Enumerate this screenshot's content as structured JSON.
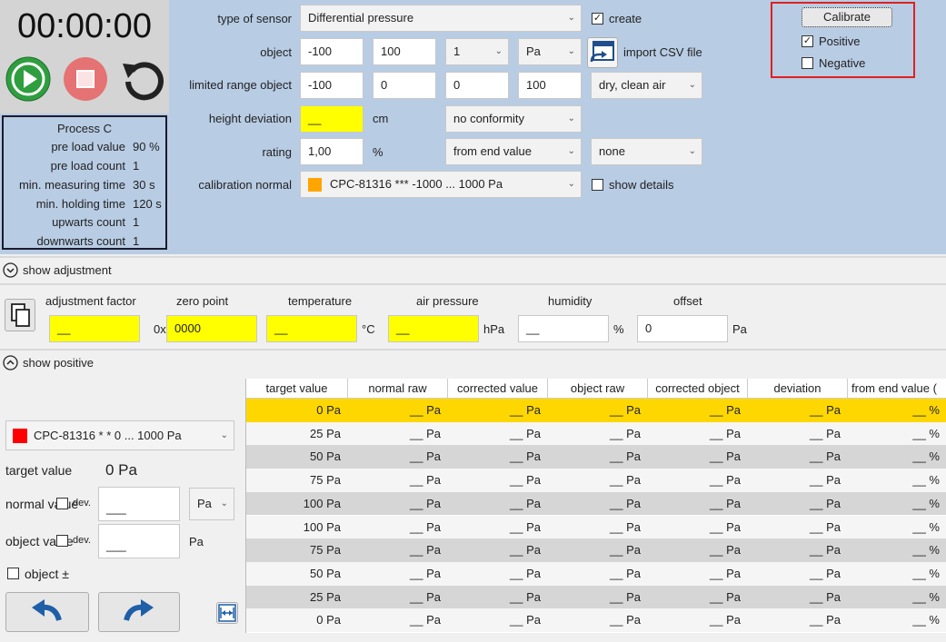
{
  "timer": {
    "display": "00:00:00"
  },
  "controls": {
    "play": "play-icon",
    "stop": "stop-icon",
    "reset": "reset-icon"
  },
  "process": {
    "title": "Process C",
    "rows": [
      {
        "label": "pre load value",
        "value": "90 %"
      },
      {
        "label": "pre load count",
        "value": "1"
      },
      {
        "label": "min. measuring time",
        "value": "30 s"
      },
      {
        "label": "min. holding time",
        "value": "120 s"
      },
      {
        "label": "upwarts count",
        "value": "1"
      },
      {
        "label": "downwarts count",
        "value": "1"
      }
    ]
  },
  "form": {
    "sensor_label": "type of sensor",
    "sensor_value": "Differential pressure",
    "create_label": "create",
    "create_checked": "✓",
    "object_label": "object",
    "object_min": "-100",
    "object_max": "100",
    "object_step": "1",
    "object_unit": "Pa",
    "import_label": "import CSV file",
    "limited_label": "limited range object",
    "limited_1": "-100",
    "limited_2": "0",
    "limited_3": "0",
    "limited_4": "100",
    "medium": "dry, clean air",
    "height_label": "height deviation",
    "height_value": "__",
    "height_unit": "cm",
    "conformity": "no conformity",
    "rating_label": "rating",
    "rating_value": "1,00",
    "rating_unit": "%",
    "rating_mode": "from end value",
    "rating_extra": "none",
    "calnormal_label": "calibration normal",
    "calnormal_value": "CPC-81316     ***   -1000 ... 1000 Pa",
    "show_details": "show details"
  },
  "calibrate": {
    "button": "Calibrate",
    "positive": "Positive",
    "positive_checked": "✓",
    "negative": "Negative"
  },
  "adjustment": {
    "toggle": "show adjustment",
    "factor_label": "adjustment factor",
    "factor_value": "__",
    "zero_label": "zero point",
    "zero_prefix": "0x",
    "zero_value": "0000",
    "temp_label": "temperature",
    "temp_value": "__",
    "temp_unit": "°C",
    "air_label": "air pressure",
    "air_value": "__",
    "air_unit": "hPa",
    "hum_label": "humidity",
    "hum_value": "__",
    "hum_unit": "%",
    "offset_label": "offset",
    "offset_value": "0",
    "offset_unit": "Pa"
  },
  "positive": {
    "toggle": "show positive",
    "device": "CPC-81316      * *   0 ... 1000 Pa",
    "target_label": "target value",
    "target_value": "0 Pa",
    "normal_label": "normal value",
    "normal_dev": "dev.",
    "normal_value": "___",
    "normal_unit": "Pa",
    "object_label": "object value",
    "object_dev": "dev.",
    "object_value": "___",
    "object_unit": "Pa",
    "object_pm": "object ±"
  },
  "table": {
    "headers": [
      "target value",
      "normal raw",
      "corrected value",
      "object raw",
      "corrected object",
      "deviation",
      "from end value ("
    ],
    "rows": [
      [
        "0 Pa",
        "__ Pa",
        "__ Pa",
        "__ Pa",
        "__ Pa",
        "__ Pa",
        "__ %"
      ],
      [
        "25 Pa",
        "__ Pa",
        "__ Pa",
        "__ Pa",
        "__ Pa",
        "__ Pa",
        "__ %"
      ],
      [
        "50 Pa",
        "__ Pa",
        "__ Pa",
        "__ Pa",
        "__ Pa",
        "__ Pa",
        "__ %"
      ],
      [
        "75 Pa",
        "__ Pa",
        "__ Pa",
        "__ Pa",
        "__ Pa",
        "__ Pa",
        "__ %"
      ],
      [
        "100 Pa",
        "__ Pa",
        "__ Pa",
        "__ Pa",
        "__ Pa",
        "__ Pa",
        "__ %"
      ],
      [
        "100 Pa",
        "__ Pa",
        "__ Pa",
        "__ Pa",
        "__ Pa",
        "__ Pa",
        "__ %"
      ],
      [
        "75 Pa",
        "__ Pa",
        "__ Pa",
        "__ Pa",
        "__ Pa",
        "__ Pa",
        "__ %"
      ],
      [
        "50 Pa",
        "__ Pa",
        "__ Pa",
        "__ Pa",
        "__ Pa",
        "__ Pa",
        "__ %"
      ],
      [
        "25 Pa",
        "__ Pa",
        "__ Pa",
        "__ Pa",
        "__ Pa",
        "__ Pa",
        "__ %"
      ],
      [
        "0 Pa",
        "__ Pa",
        "__ Pa",
        "__ Pa",
        "__ Pa",
        "__ Pa",
        "__ %"
      ]
    ]
  },
  "colors": {
    "panel_bg": "#b8cce4",
    "highlight_row": "#ffd700",
    "field_highlight": "#ffff00",
    "play": "#2e9e3e",
    "stop": "#e57373",
    "calnormal_swatch": "#ffa500",
    "device_swatch": "#ff0000",
    "callout": "#e02020"
  }
}
